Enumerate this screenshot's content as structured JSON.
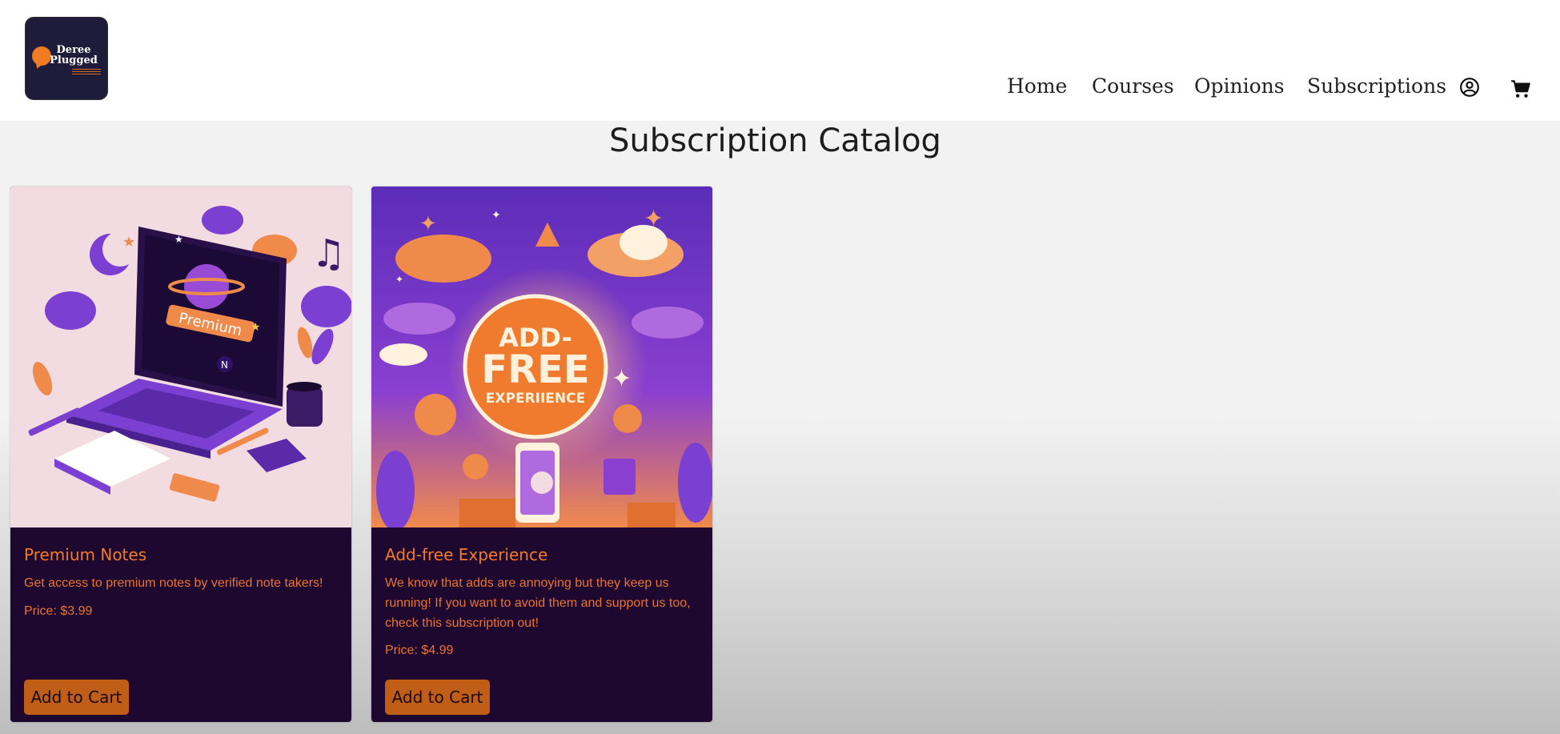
{
  "brand": {
    "logo_line1": "Deree",
    "logo_line2": "Plugged"
  },
  "nav": {
    "links": [
      "Home",
      "Courses",
      "Opinions",
      "Subscriptions"
    ],
    "account_icon": "user-circle-icon",
    "cart_icon": "shopping-cart-icon"
  },
  "page": {
    "title": "Subscription Catalog"
  },
  "products": [
    {
      "title": "Premium Notes",
      "description": "Get access to premium notes by verified note takers!",
      "price": "Price: $3.99",
      "button": "Add to Cart",
      "image_text": "Premium",
      "image_badge": "N"
    },
    {
      "title": "Add-free Experience",
      "description": "We know that adds are annoying but they keep us running! If you want to avoid them and support us too, check this subscription out!",
      "price": "Price: $4.99",
      "button": "Add to Cart",
      "image_text_1": "ADD-",
      "image_text_2": "FREE",
      "image_text_3": "EXPERIIENCE"
    }
  ],
  "colors": {
    "card_bg": "#1f0830",
    "accent_orange": "#f07b2e",
    "button_bg": "#c05d16",
    "logo_bg": "#1f1b3a"
  }
}
